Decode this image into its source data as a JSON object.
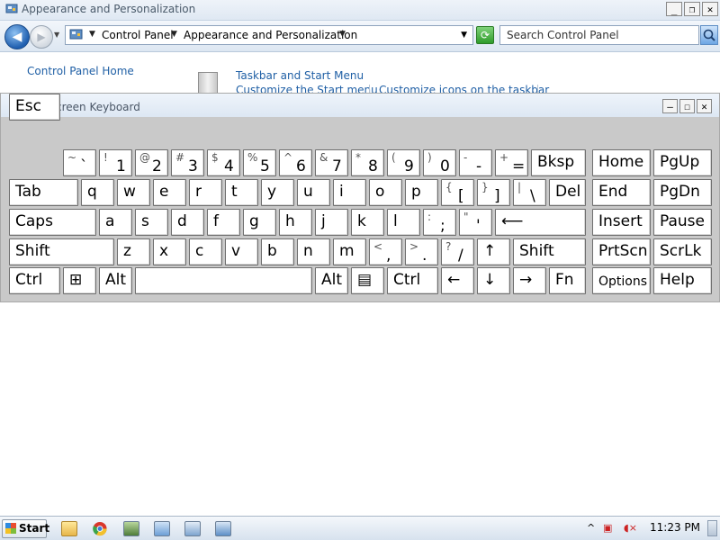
{
  "window": {
    "title": "Appearance and Personalization",
    "controls": {
      "minimize": "_",
      "restore": "❐",
      "close": "✕"
    }
  },
  "address": {
    "crumbs": [
      "Control Panel",
      "Appearance and Personalization"
    ],
    "search_placeholder": "Search Control Panel"
  },
  "content": {
    "home_link": "Control Panel Home",
    "taskbar_link": "Taskbar and Start Menu",
    "sub_links": [
      "Customize the Start menu",
      "Customize icons on the taskbar"
    ]
  },
  "osk": {
    "title": "On-Screen Keyboard",
    "controls": {
      "minimize": "—",
      "maximize": "☐",
      "close": "✕"
    },
    "keys": [
      {
        "id": "esc",
        "label": "Esc"
      },
      {
        "id": "backtick",
        "shift": "~",
        "base": "`"
      },
      {
        "id": "1",
        "shift": "!",
        "base": "1"
      },
      {
        "id": "2",
        "shift": "@",
        "base": "2"
      },
      {
        "id": "3",
        "shift": "#",
        "base": "3"
      },
      {
        "id": "4",
        "shift": "$",
        "base": "4"
      },
      {
        "id": "5",
        "shift": "%",
        "base": "5"
      },
      {
        "id": "6",
        "shift": "^",
        "base": "6"
      },
      {
        "id": "7",
        "shift": "&",
        "base": "7"
      },
      {
        "id": "8",
        "shift": "*",
        "base": "8"
      },
      {
        "id": "9",
        "shift": "(",
        "base": "9"
      },
      {
        "id": "0",
        "shift": ")",
        "base": "0"
      },
      {
        "id": "minus",
        "shift": "-",
        "base": "-"
      },
      {
        "id": "equals",
        "shift": "+",
        "base": "="
      },
      {
        "id": "bksp",
        "label": "Bksp"
      },
      {
        "id": "home",
        "label": "Home"
      },
      {
        "id": "pgup",
        "label": "PgUp"
      },
      {
        "id": "tab",
        "label": "Tab"
      },
      {
        "id": "q",
        "label": "q"
      },
      {
        "id": "w",
        "label": "w"
      },
      {
        "id": "e",
        "label": "e"
      },
      {
        "id": "r",
        "label": "r"
      },
      {
        "id": "t",
        "label": "t"
      },
      {
        "id": "y",
        "label": "y"
      },
      {
        "id": "u",
        "label": "u"
      },
      {
        "id": "i",
        "label": "i"
      },
      {
        "id": "o",
        "label": "o"
      },
      {
        "id": "p",
        "label": "p"
      },
      {
        "id": "lbracket",
        "shift": "{",
        "base": "["
      },
      {
        "id": "rbracket",
        "shift": "}",
        "base": "]"
      },
      {
        "id": "backslash",
        "shift": "|",
        "base": "\\"
      },
      {
        "id": "del",
        "label": "Del"
      },
      {
        "id": "end",
        "label": "End"
      },
      {
        "id": "pgdn",
        "label": "PgDn"
      },
      {
        "id": "caps",
        "label": "Caps"
      },
      {
        "id": "a",
        "label": "a"
      },
      {
        "id": "s",
        "label": "s"
      },
      {
        "id": "d",
        "label": "d"
      },
      {
        "id": "f",
        "label": "f"
      },
      {
        "id": "g",
        "label": "g"
      },
      {
        "id": "h",
        "label": "h"
      },
      {
        "id": "j",
        "label": "j"
      },
      {
        "id": "k",
        "label": "k"
      },
      {
        "id": "l",
        "label": "l"
      },
      {
        "id": "semicolon",
        "shift": ":",
        "base": ";"
      },
      {
        "id": "quote",
        "shift": "\"",
        "base": "'"
      },
      {
        "id": "enter",
        "label": "⟵"
      },
      {
        "id": "insert",
        "label": "Insert"
      },
      {
        "id": "pause",
        "label": "Pause"
      },
      {
        "id": "lshift",
        "label": "Shift"
      },
      {
        "id": "z",
        "label": "z"
      },
      {
        "id": "x",
        "label": "x"
      },
      {
        "id": "c",
        "label": "c"
      },
      {
        "id": "v",
        "label": "v"
      },
      {
        "id": "b",
        "label": "b"
      },
      {
        "id": "n",
        "label": "n"
      },
      {
        "id": "m",
        "label": "m"
      },
      {
        "id": "comma",
        "shift": "<",
        "base": ","
      },
      {
        "id": "period",
        "shift": ">",
        "base": "."
      },
      {
        "id": "slash",
        "shift": "?",
        "base": "/"
      },
      {
        "id": "up",
        "label": "↑"
      },
      {
        "id": "rshift",
        "label": "Shift"
      },
      {
        "id": "prtscn",
        "label": "PrtScn"
      },
      {
        "id": "scrlk",
        "label": "ScrLk"
      },
      {
        "id": "lctrl",
        "label": "Ctrl"
      },
      {
        "id": "win",
        "label": "⊞"
      },
      {
        "id": "lalt",
        "label": "Alt"
      },
      {
        "id": "space",
        "label": ""
      },
      {
        "id": "ralt",
        "label": "Alt"
      },
      {
        "id": "menu",
        "label": "▤"
      },
      {
        "id": "rctrl",
        "label": "Ctrl"
      },
      {
        "id": "left",
        "label": "←"
      },
      {
        "id": "down",
        "label": "↓"
      },
      {
        "id": "right",
        "label": "→"
      },
      {
        "id": "fn",
        "label": "Fn"
      },
      {
        "id": "options",
        "label": "Options"
      },
      {
        "id": "help",
        "label": "Help"
      }
    ]
  },
  "taskbar": {
    "start_label": "Start",
    "clock": "11:23 PM"
  }
}
